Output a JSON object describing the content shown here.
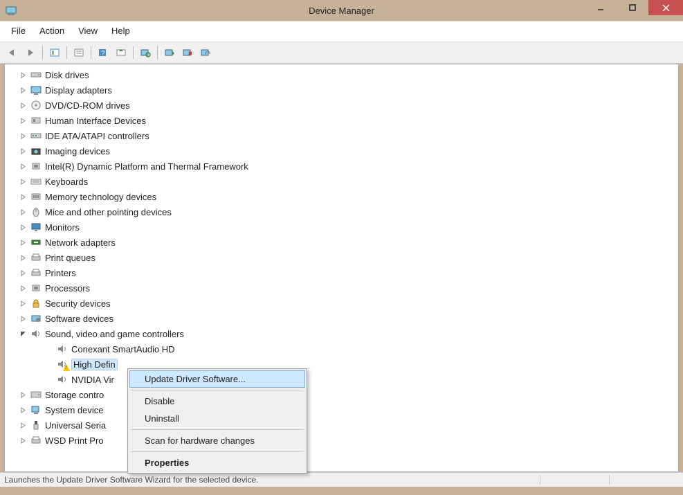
{
  "window": {
    "title": "Device Manager"
  },
  "menubar": [
    "File",
    "Action",
    "View",
    "Help"
  ],
  "toolbar_icons": [
    "back",
    "forward",
    "sep",
    "show-hidden",
    "sep",
    "properties",
    "sep",
    "help",
    "update",
    "sep",
    "scan",
    "sep",
    "enable",
    "disable",
    "uninstall"
  ],
  "tree": [
    {
      "icon": "disk",
      "label": "Disk drives",
      "expanded": false
    },
    {
      "icon": "display",
      "label": "Display adapters",
      "expanded": false
    },
    {
      "icon": "dvd",
      "label": "DVD/CD-ROM drives",
      "expanded": false
    },
    {
      "icon": "hid",
      "label": "Human Interface Devices",
      "expanded": false
    },
    {
      "icon": "ide",
      "label": "IDE ATA/ATAPI controllers",
      "expanded": false
    },
    {
      "icon": "imaging",
      "label": "Imaging devices",
      "expanded": false
    },
    {
      "icon": "cpu",
      "label": "Intel(R) Dynamic Platform and Thermal Framework",
      "expanded": false
    },
    {
      "icon": "keyboard",
      "label": "Keyboards",
      "expanded": false
    },
    {
      "icon": "memory",
      "label": "Memory technology devices",
      "expanded": false
    },
    {
      "icon": "mouse",
      "label": "Mice and other pointing devices",
      "expanded": false
    },
    {
      "icon": "monitor",
      "label": "Monitors",
      "expanded": false
    },
    {
      "icon": "network",
      "label": "Network adapters",
      "expanded": false
    },
    {
      "icon": "printqueue",
      "label": "Print queues",
      "expanded": false
    },
    {
      "icon": "printer",
      "label": "Printers",
      "expanded": false
    },
    {
      "icon": "processor",
      "label": "Processors",
      "expanded": false
    },
    {
      "icon": "security",
      "label": "Security devices",
      "expanded": false
    },
    {
      "icon": "software",
      "label": "Software devices",
      "expanded": false
    },
    {
      "icon": "sound",
      "label": "Sound, video and game controllers",
      "expanded": true,
      "children": [
        {
          "icon": "speaker",
          "label": "Conexant SmartAudio HD",
          "warn": false
        },
        {
          "icon": "speaker",
          "label": "High Defin",
          "warn": true,
          "selected": true,
          "partial": true
        },
        {
          "icon": "speaker",
          "label": "NVIDIA Vir",
          "warn": false,
          "partial": true
        }
      ]
    },
    {
      "icon": "storage",
      "label": "Storage contro",
      "expanded": false,
      "partial": true
    },
    {
      "icon": "system",
      "label": "System device",
      "expanded": false,
      "partial": true
    },
    {
      "icon": "usb",
      "label": "Universal Seria",
      "expanded": false,
      "partial": true
    },
    {
      "icon": "wsd",
      "label": "WSD Print Pro",
      "expanded": false,
      "partial": true
    }
  ],
  "context_menu": {
    "items": [
      {
        "label": "Update Driver Software...",
        "highlight": true
      },
      {
        "sep": true
      },
      {
        "label": "Disable"
      },
      {
        "label": "Uninstall"
      },
      {
        "sep": true
      },
      {
        "label": "Scan for hardware changes"
      },
      {
        "sep": true
      },
      {
        "label": "Properties",
        "bold": true
      }
    ]
  },
  "statusbar": {
    "text": "Launches the Update Driver Software Wizard for the selected device."
  }
}
